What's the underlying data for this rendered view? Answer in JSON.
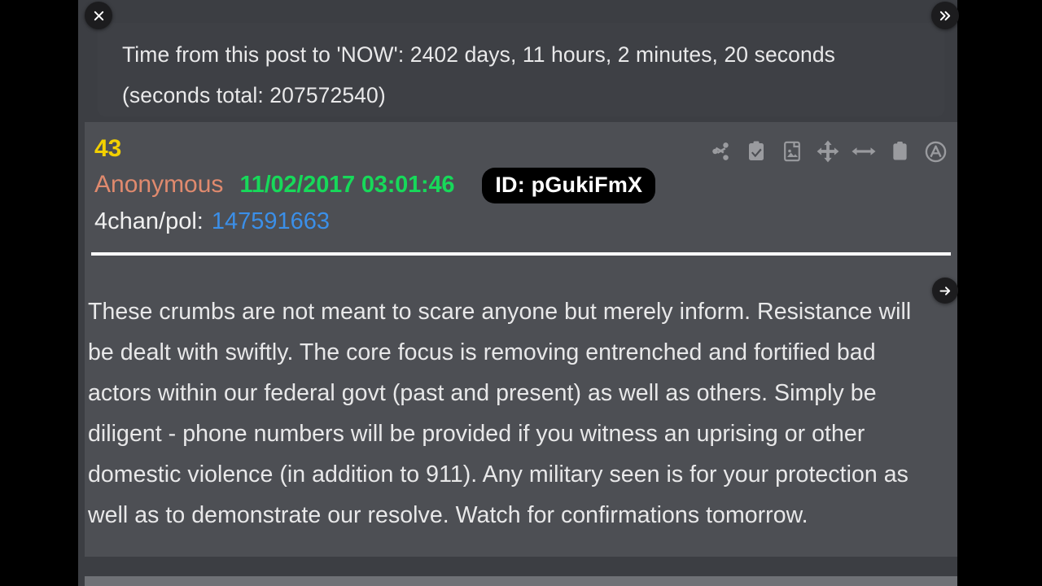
{
  "window": {
    "background_color": "#000000",
    "frame_color": "#3c3e43"
  },
  "controls": {
    "close_label": "✕",
    "close_icon": "close-icon",
    "next_chevron_label": "»",
    "next_chevron_icon": "double-chevron-right-icon",
    "forward_arrow_label": "→",
    "forward_arrow_icon": "arrow-right-icon"
  },
  "time_banner": {
    "text": "Time from this post to 'NOW': 2402 days, 11 hours, 2 minutes, 20 seconds   (seconds total: 207572540)",
    "days": 2402,
    "hours": 11,
    "minutes": 2,
    "seconds": 20,
    "seconds_total": 207572540,
    "background_color": "#3e4045",
    "text_color": "#e9e9ea"
  },
  "post": {
    "number": "43",
    "number_color": "#f2d000",
    "author": "Anonymous",
    "author_color": "#e08a6e",
    "date": "11/02/2017 03:01:46",
    "date_color": "#17d95a",
    "id_badge": "ID: pGukiFmX",
    "id_badge_background": "#000000",
    "source_label": "4chan/pol:",
    "source_id": "147591663",
    "source_link_color": "#3b8fe8",
    "divider_color": "#ffffff",
    "body": "These crumbs are not meant to scare anyone but merely inform. Resistance will be dealt with swiftly. The core focus is removing entrenched and fortified bad actors within our federal govt (past and present) as well as others. Simply be diligent - phone numbers will be provided if you witness an uprising or other domestic violence (in addition to 911). Any military seen is for your protection as well as to demonstrate our resolve. Watch for confirmations tomorrow.",
    "background_color": "#4d4f54"
  },
  "toolbar": {
    "icons": [
      {
        "name": "share-icon",
        "label": "Share"
      },
      {
        "name": "clipboard-check-icon",
        "label": "Copy text"
      },
      {
        "name": "document-image-icon",
        "label": "Copy image"
      },
      {
        "name": "move-arrows-icon",
        "label": "Move"
      },
      {
        "name": "resize-horizontal-icon",
        "label": "Resize width"
      },
      {
        "name": "clipboard-icon",
        "label": "Clipboard"
      },
      {
        "name": "circle-a-icon",
        "label": "Font size"
      }
    ]
  }
}
